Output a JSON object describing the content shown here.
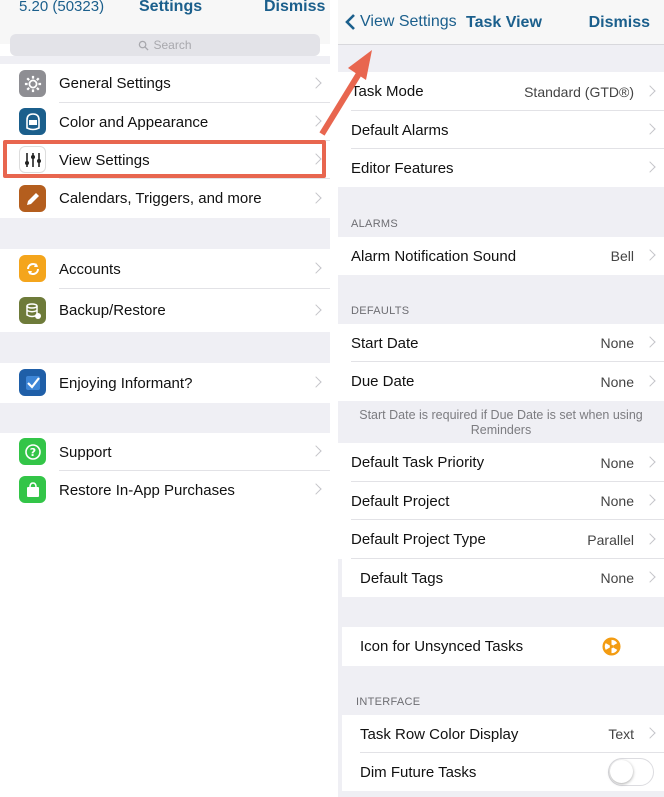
{
  "left": {
    "nav": {
      "version": "5.20 (50323)",
      "title": "Settings",
      "dismiss": "Dismiss"
    },
    "search": {
      "placeholder": "Search"
    },
    "items": [
      {
        "label": "General Settings",
        "icon": "gear-icon",
        "color": "#8e8e93"
      },
      {
        "label": "Color and Appearance",
        "icon": "palette-icon",
        "color": "#1b5f8c"
      },
      {
        "label": "View Settings",
        "icon": "sliders-icon",
        "color": "#ffffff"
      },
      {
        "label": "Calendars, Triggers, and more",
        "icon": "pencil-icon",
        "color": "#b45e1e"
      },
      {
        "label": "Accounts",
        "icon": "sync-icon",
        "color": "#f4a51c"
      },
      {
        "label": "Backup/Restore",
        "icon": "database-icon",
        "color": "#6e7b3a"
      },
      {
        "label": "Enjoying Informant?",
        "icon": "checkmark-icon",
        "color": "#1f5fa8"
      },
      {
        "label": "Support",
        "icon": "question-icon",
        "color": "#33c548"
      },
      {
        "label": "Restore In-App Purchases",
        "icon": "shopping-bag-icon",
        "color": "#33c548"
      }
    ]
  },
  "right": {
    "nav": {
      "back": "View Settings",
      "title": "Task View",
      "dismiss": "Dismiss"
    },
    "rows_top": [
      {
        "label": "Task Mode",
        "value": "Standard (GTD®)"
      },
      {
        "label": "Default Alarms",
        "value": ""
      },
      {
        "label": "Editor Features",
        "value": ""
      }
    ],
    "alarms_header": "ALARMS",
    "alarm_sound": {
      "label": "Alarm Notification Sound",
      "value": "Bell"
    },
    "defaults_header": "DEFAULTS",
    "start_date": {
      "label": "Start Date",
      "value": "None"
    },
    "due_date": {
      "label": "Due Date",
      "value": "None"
    },
    "note": "Start Date is required if Due Date is set when using Reminders",
    "priority": {
      "label": "Default Task Priority",
      "value": "None"
    },
    "project": {
      "label": "Default Project",
      "value": "None"
    },
    "project_type": {
      "label": "Default Project Type",
      "value": "Parallel"
    },
    "tags": {
      "label": "Default Tags",
      "value": "None"
    },
    "unsynced": {
      "label": "Icon for Unsynced Tasks",
      "icon": "radiation-icon",
      "color": "#f39c12"
    },
    "interface_header": "INTERFACE",
    "row_color": {
      "label": "Task Row Color Display",
      "value": "Text"
    },
    "dim_future": {
      "label": "Dim Future Tasks",
      "on": false
    }
  },
  "colors": {
    "accent": "#1b5f8c",
    "highlight": "#e8664f"
  }
}
